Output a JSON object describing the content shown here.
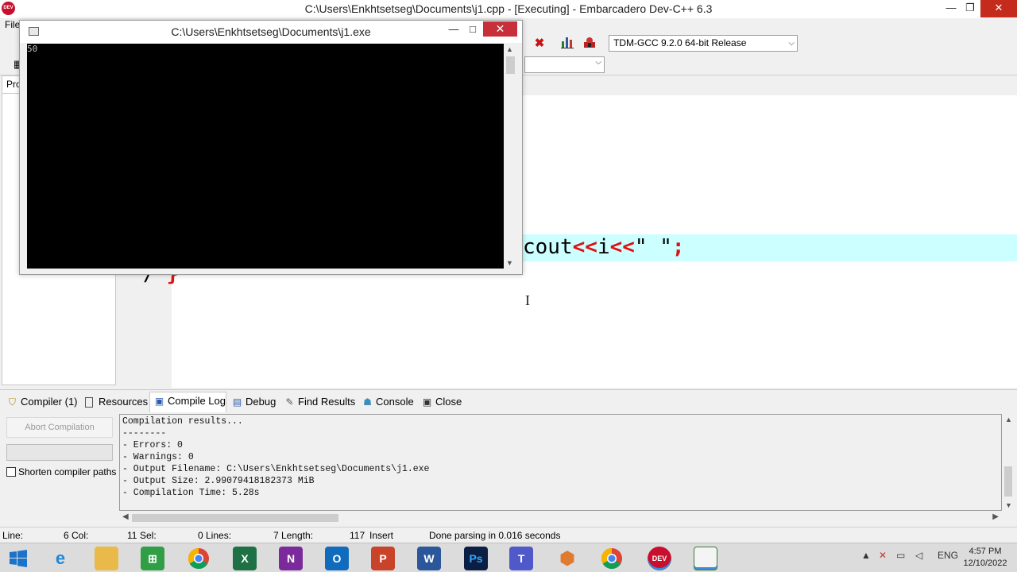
{
  "window": {
    "title": "C:\\Users\\Enkhtsetseg\\Documents\\j1.cpp - [Executing] - Embarcadero Dev-C++ 6.3",
    "icon_text": "DEV",
    "minimize_glyph": "—",
    "maximize_glyph": "❐",
    "close_glyph": "✕"
  },
  "menu": {
    "file_label": "File"
  },
  "toolbar": {
    "compiler_select": "TDM-GCC 9.2.0 64-bit Release",
    "icons": [
      "stop-execution-icon",
      "chart-icon",
      "profile-icon"
    ]
  },
  "project_panel": {
    "tab_label": "Project"
  },
  "editor": {
    "line1": "cout<<i<<\" \";",
    "line2_prefix": "/",
    "line2_brace": "}"
  },
  "console": {
    "title": "C:\\Users\\Enkhtsetseg\\Documents\\j1.exe",
    "output": "50",
    "minimize_glyph": "—",
    "maximize_glyph": "□",
    "close_glyph": "✕"
  },
  "bottom_tabs": [
    {
      "label": "Compiler (1)",
      "icon": "compiler-icon"
    },
    {
      "label": "Resources",
      "icon": "resources-icon"
    },
    {
      "label": "Compile Log",
      "icon": "compile-log-icon",
      "active": true
    },
    {
      "label": "Debug",
      "icon": "debug-icon"
    },
    {
      "label": "Find Results",
      "icon": "find-results-icon"
    },
    {
      "label": "Console",
      "icon": "console-icon"
    },
    {
      "label": "Close",
      "icon": "close-panel-icon"
    }
  ],
  "compile_panel": {
    "abort_button": "Abort Compilation",
    "shorten_label": "Shorten compiler paths",
    "shorten_checked": false
  },
  "compile_log": [
    "Compilation results...",
    "--------",
    "- Errors: 0",
    "- Warnings: 0",
    "- Output Filename: C:\\Users\\Enkhtsetseg\\Documents\\j1.exe",
    "- Output Size: 2.99079418182373 MiB",
    "- Compilation Time: 5.28s"
  ],
  "statusbar": {
    "line_label": "Line:",
    "line_value": "6",
    "col_label": "Col:",
    "col_value": "11",
    "sel_label": "Sel:",
    "sel_value": "0",
    "lines_label": "Lines:",
    "lines_value": "7",
    "length_label": "Length:",
    "length_value": "117",
    "mode": "Insert",
    "message": "Done parsing in 0.016 seconds"
  },
  "taskbar": {
    "apps": [
      {
        "name": "windows-start-icon",
        "color": "#1a73c9"
      },
      {
        "name": "internet-explorer-icon",
        "color": "#1e88d8"
      },
      {
        "name": "file-explorer-icon",
        "color": "#e9b949"
      },
      {
        "name": "store-icon",
        "color": "#2f9e44"
      },
      {
        "name": "chrome-icon",
        "color": "#db4437"
      },
      {
        "name": "excel-icon",
        "color": "#1d7144"
      },
      {
        "name": "onenote-icon",
        "color": "#7b2a9c"
      },
      {
        "name": "outlook-icon",
        "color": "#0f6cbd"
      },
      {
        "name": "powerpoint-icon",
        "color": "#c9432b"
      },
      {
        "name": "word-icon",
        "color": "#2b579a"
      },
      {
        "name": "photoshop-icon",
        "color": "#0b1f44"
      },
      {
        "name": "teams-icon",
        "color": "#5059c9"
      },
      {
        "name": "3d-builder-icon",
        "color": "#e07a2e"
      },
      {
        "name": "chrome-icon",
        "color": "#db4437"
      },
      {
        "name": "devcpp-icon",
        "color": "#c8102e"
      },
      {
        "name": "console-window-icon",
        "color": "#3a7a3a"
      }
    ],
    "tray_language": "ENG",
    "time": "4:57 PM",
    "date": "12/10/2022"
  }
}
